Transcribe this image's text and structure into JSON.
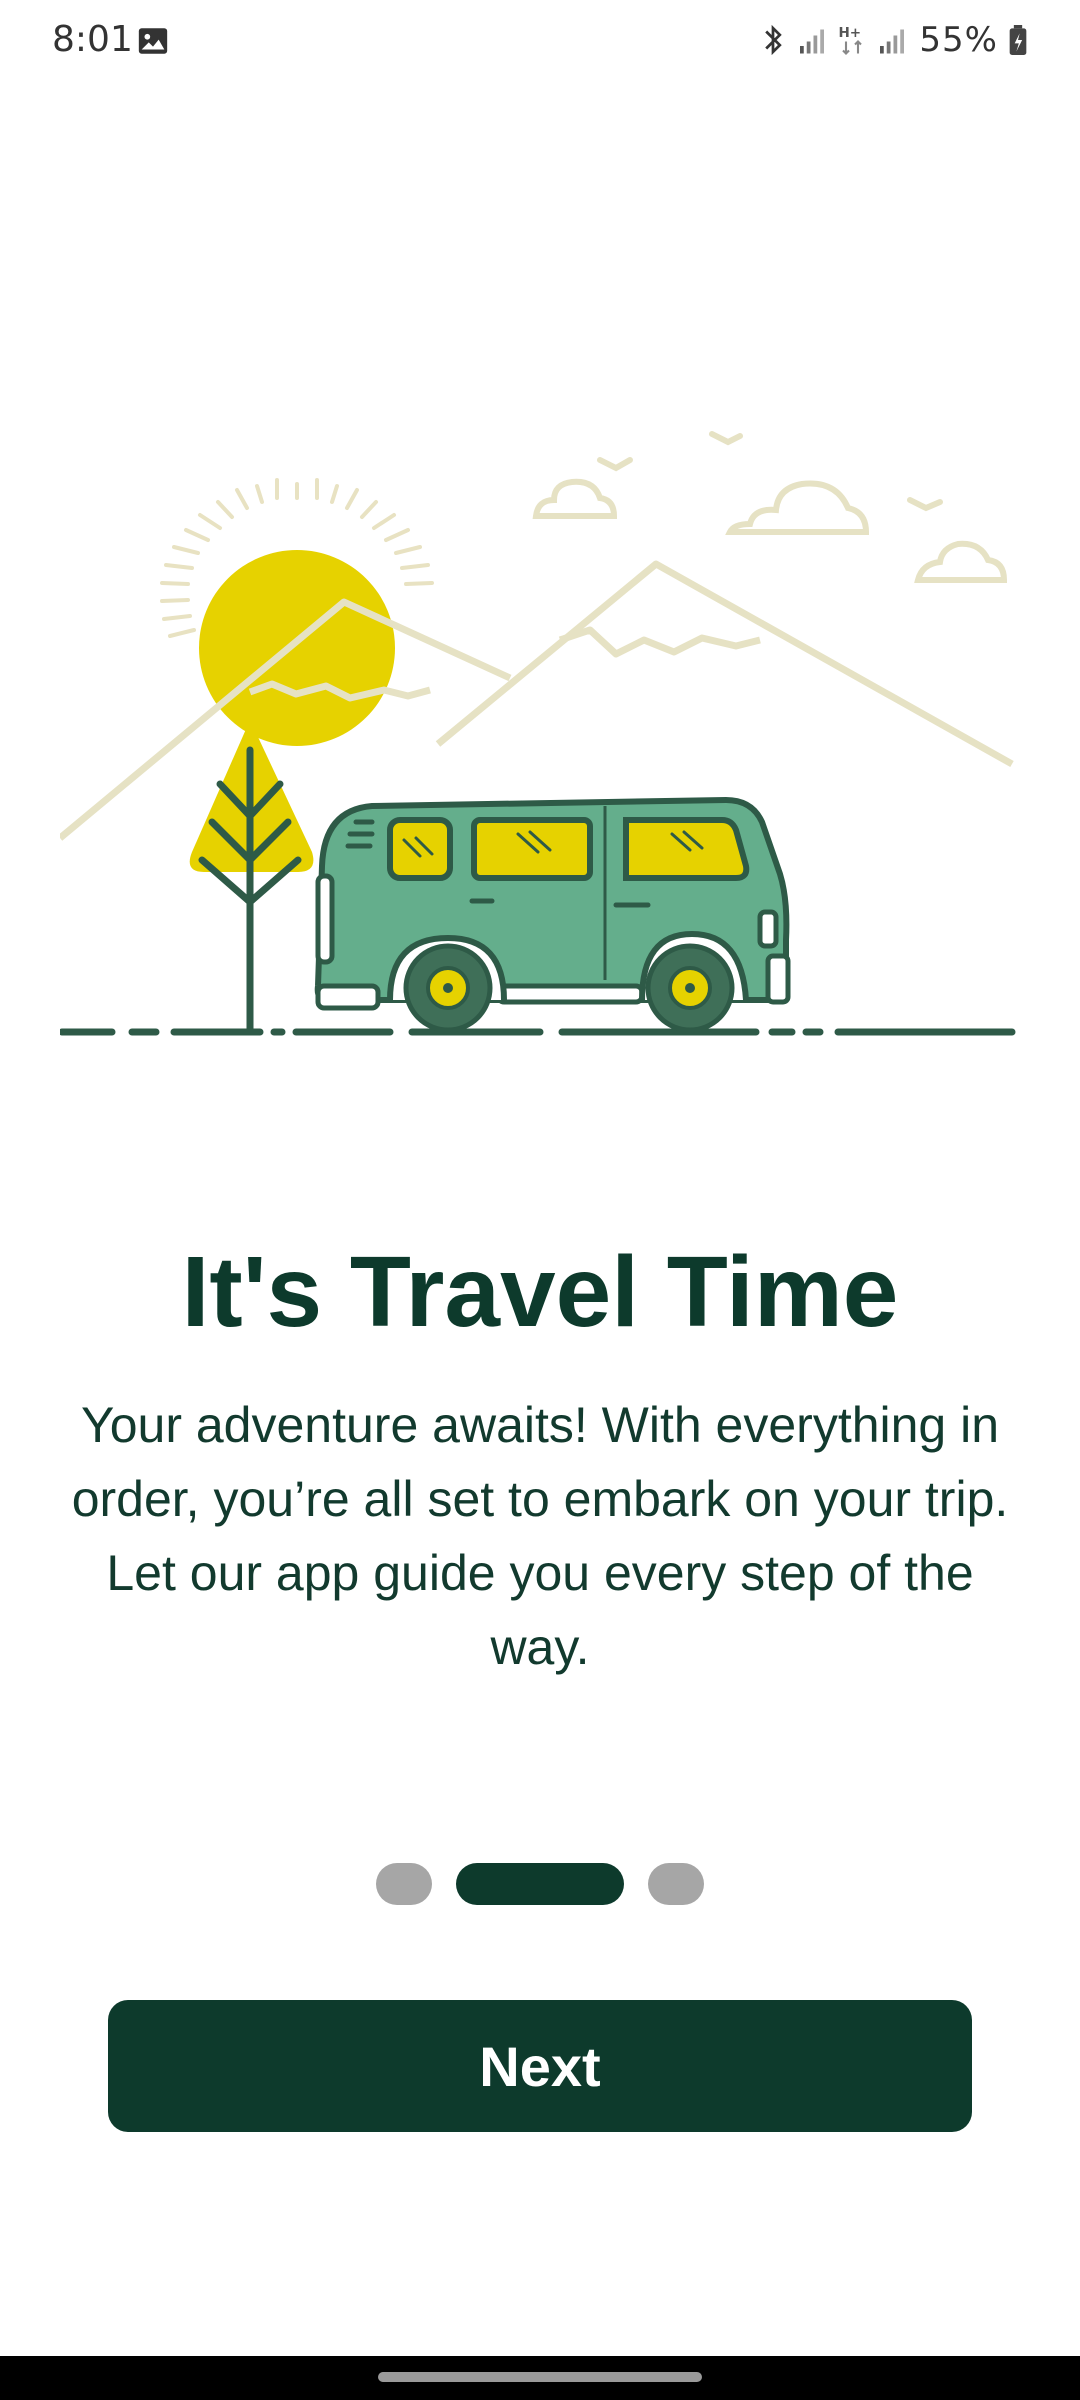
{
  "status_bar": {
    "time": "8:01",
    "battery": "55%",
    "icons": [
      "image-icon",
      "bluetooth-icon",
      "signal-icon",
      "h-plus-data-icon",
      "signal-icon",
      "battery-icon"
    ]
  },
  "illustration": {
    "subject": "van-travel-illustration",
    "colors": {
      "sun": "#e6d200",
      "mountains": "#e6e2c4",
      "van_body": "#64ae8c",
      "outline": "#2e5a47",
      "windows": "#e6d200"
    }
  },
  "onboarding": {
    "title": "It's Travel Time",
    "description": "Your adventure awaits! With everything in order, you’re all set to embark on your trip. Let our app guide you every step of the way.",
    "page_index": 2,
    "page_count": 3
  },
  "actions": {
    "next_label": "Next"
  },
  "colors": {
    "primary": "#0d3a2c",
    "dot_inactive": "#a6a6a6"
  }
}
